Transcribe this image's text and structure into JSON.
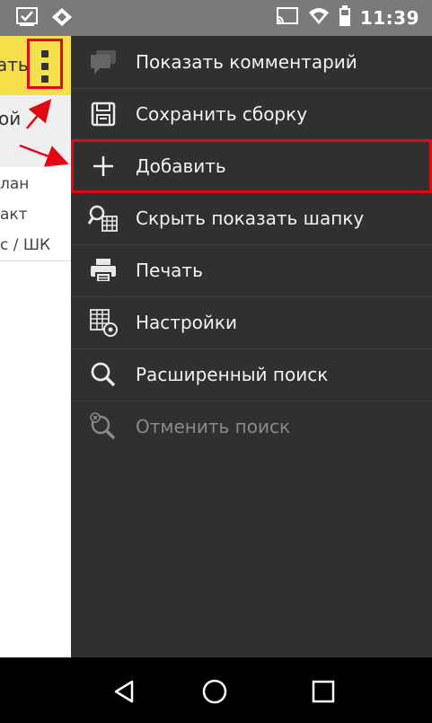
{
  "status_bar": {
    "time": "11:39",
    "left_icons": [
      "checkbox-icon",
      "diamond-icon"
    ],
    "right_icons": [
      "cast-icon",
      "wifi-icon",
      "battery-icon"
    ]
  },
  "background_app": {
    "toolbar_partial_label": "ать",
    "header_partial_text": "ой",
    "list_items": [
      "лан",
      "акт",
      "с / ШК"
    ],
    "accent_color": "#f5df4b"
  },
  "menu": {
    "items": [
      {
        "label": "Показать комментарий",
        "icon": "comment-icon",
        "enabled": true
      },
      {
        "label": "Сохранить сборку",
        "icon": "save-icon",
        "enabled": true
      },
      {
        "label": "Добавить",
        "icon": "plus-icon",
        "enabled": true,
        "highlighted": true
      },
      {
        "label": "Скрыть показать шапку",
        "icon": "search-table-icon",
        "enabled": true
      },
      {
        "label": "Печать",
        "icon": "printer-icon",
        "enabled": true
      },
      {
        "label": "Настройки",
        "icon": "table-settings-icon",
        "enabled": true
      },
      {
        "label": "Расширенный поиск",
        "icon": "search-icon",
        "enabled": true
      },
      {
        "label": "Отменить поиск",
        "icon": "cancel-search-icon",
        "enabled": false
      }
    ],
    "background_color": "#303030",
    "highlight_color": "#e30613"
  },
  "nav_bar": {
    "buttons": [
      "back-icon",
      "home-icon",
      "recents-icon"
    ]
  }
}
